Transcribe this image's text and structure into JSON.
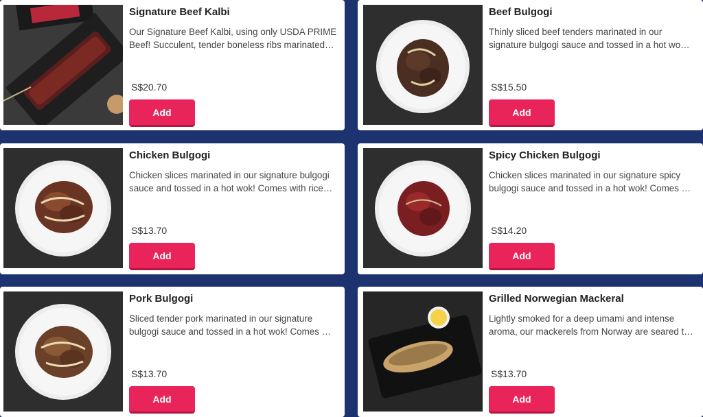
{
  "menu": {
    "items": [
      {
        "title": "Signature Beef Kalbi",
        "description": "Our Signature Beef Kalbi, using only USDA PRIME Beef! Succulent, tender boneless ribs marinated…",
        "price": "S$20.70",
        "add_label": "Add",
        "image": "beef-kalbi-photo"
      },
      {
        "title": "Beef Bulgogi",
        "description": "Thinly sliced beef tenders marinated in our signature bulgogi sauce and tossed in a hot wo…",
        "price": "S$15.50",
        "add_label": "Add",
        "image": "beef-bulgogi-photo"
      },
      {
        "title": "Chicken Bulgogi",
        "description": "Chicken slices marinated in our signature bulgogi sauce and tossed in a hot wok! Comes with rice…",
        "price": "S$13.70",
        "add_label": "Add",
        "image": "chicken-bulgogi-photo"
      },
      {
        "title": "Spicy Chicken Bulgogi",
        "description": "Chicken slices marinated in our signature spicy bulgogi sauce and tossed in a hot wok! Comes …",
        "price": "S$14.20",
        "add_label": "Add",
        "image": "spicy-chicken-bulgogi-photo"
      },
      {
        "title": "Pork Bulgogi",
        "description": "Sliced tender pork marinated in our signature bulgogi sauce and tossed in a hot wok! Comes …",
        "price": "S$13.70",
        "add_label": "Add",
        "image": "pork-bulgogi-photo"
      },
      {
        "title": "Grilled Norwegian Mackeral",
        "description": "Lightly smoked for a deep umami and intense aroma, our mackerels from Norway are seared t…",
        "price": "S$13.70",
        "add_label": "Add",
        "image": "grilled-mackerel-photo"
      }
    ]
  },
  "colors": {
    "background": "#1c3370",
    "add_button": "#e8245a",
    "card": "#ffffff"
  }
}
